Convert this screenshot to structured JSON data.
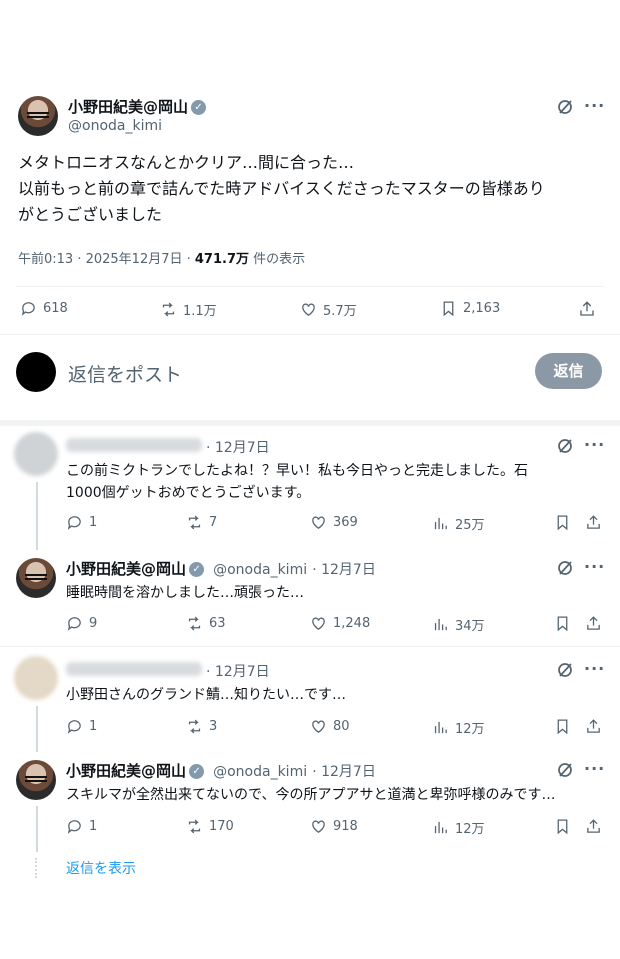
{
  "main_post": {
    "name": "小野田紀美@岡山",
    "handle": "@onoda_kimi",
    "text_lines": [
      "メタトロニオスなんとかクリア…間に合った…",
      "以前もっと前の章で詰んでた時アドバイスくださったマスターの皆様あり",
      "がとうございました"
    ],
    "time": "午前0:13 · 2025年12月7日 · ",
    "views_count": "471.7万",
    "views_label": " 件の表示",
    "stats": {
      "replies": "618",
      "reposts": "1.1万",
      "likes": "5.7万",
      "bookmarks": "2,163"
    }
  },
  "reply_box": {
    "placeholder": "返信をポスト",
    "button_label": "返信"
  },
  "replies": [
    {
      "date": "· 12月7日",
      "text_lines": [
        "この前ミクトランでしたよね！？早い！私も今日やっと完走しました。石",
        "1000個ゲットおめでとうございます。"
      ],
      "stats": {
        "replies": "1",
        "reposts": "7",
        "likes": "369",
        "views": "25万"
      }
    },
    {
      "name": "小野田紀美@岡山",
      "handle": "@onoda_kimi",
      "date": "· 12月7日",
      "text": "睡眠時間を溶かしました…頑張った…",
      "stats": {
        "replies": "9",
        "reposts": "63",
        "likes": "1,248",
        "views": "34万"
      }
    },
    {
      "date": "· 12月7日",
      "text": "小野田さんのグランド鯖…知りたい…です…",
      "stats": {
        "replies": "1",
        "reposts": "3",
        "likes": "80",
        "views": "12万"
      }
    },
    {
      "name": "小野田紀美@岡山",
      "handle": "@onoda_kimi",
      "date": "· 12月7日",
      "text": "スキルマが全然出来てないので、今の所アプアサと道満と卑弥呼様のみです…",
      "stats": {
        "replies": "1",
        "reposts": "170",
        "likes": "918",
        "views": "12万"
      }
    }
  ],
  "show_replies": "返信を表示",
  "colors": {
    "link_blue": "#1d9bf0",
    "verified_grey": "#829aab",
    "muted_text": "#536471"
  },
  "icons": [
    "grok-icon",
    "more-icon",
    "reply-icon",
    "repost-icon",
    "like-icon",
    "bookmark-icon",
    "share-icon",
    "views-icon",
    "verified-badge-icon"
  ]
}
